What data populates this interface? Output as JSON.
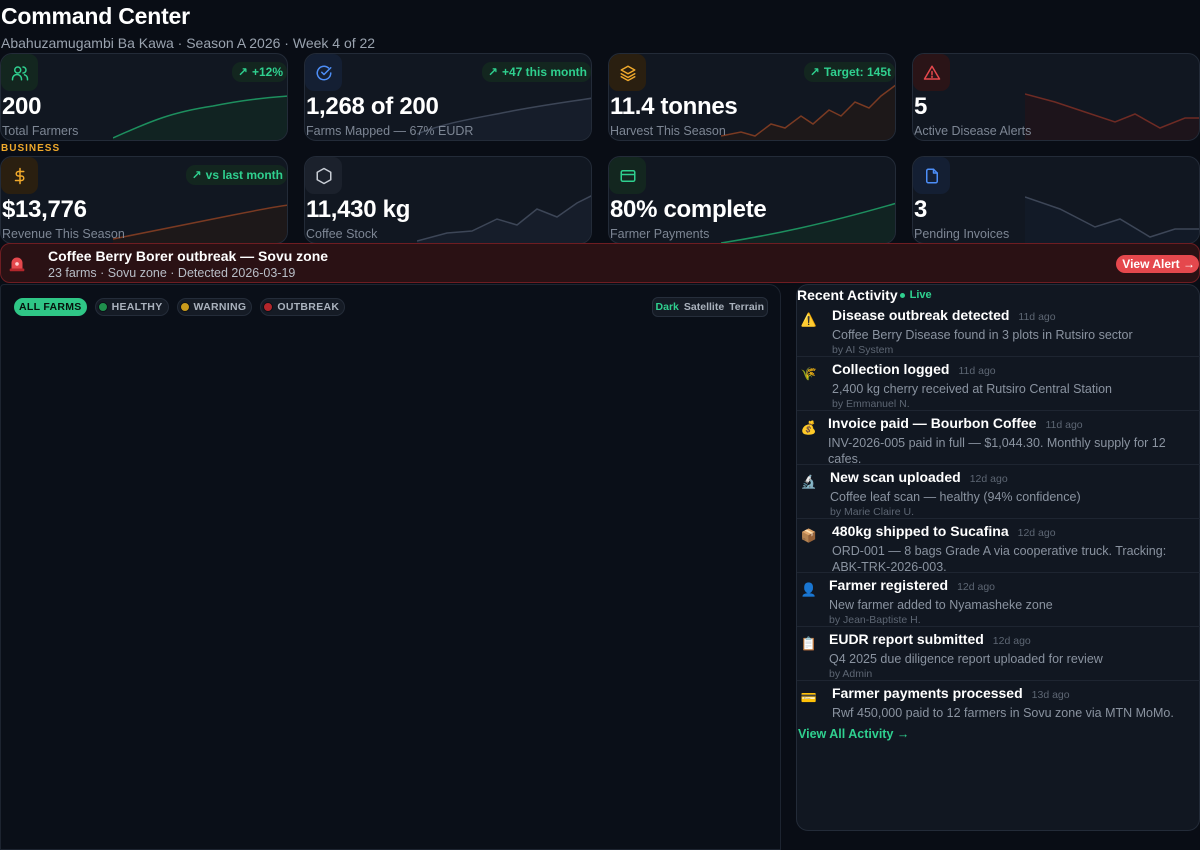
{
  "header": {
    "title": "Command Center",
    "subtitle": "Abahuzamugambi Ba Kawa · Season A 2026 · Week 4 of 22"
  },
  "colors": {
    "accent_green": "#2fd08f",
    "warning_orange": "#f0a92b",
    "danger_red": "#e5484d",
    "blue": "#4d8ef7",
    "background": "#090d15"
  },
  "stats": [
    {
      "icon": "users-icon",
      "value": "200",
      "label": "Total Farmers",
      "trend": "+12%",
      "icon_color": "#2fd08f"
    },
    {
      "icon": "check-circle-icon",
      "value": "1,268 of 200",
      "label": "Farms Mapped — 67% EUDR",
      "trend": "+47 this month",
      "icon_color": "#4d8ef7"
    },
    {
      "icon": "layers-icon",
      "value": "11.4 tonnes",
      "label": "Harvest This Season",
      "trend": "Target: 145t",
      "icon_color": "#f0a92b"
    },
    {
      "icon": "alert-triangle-icon",
      "value": "5",
      "label": "Active Disease Alerts",
      "trend": "",
      "icon_color": "#e5484d"
    }
  ],
  "business_label": "BUSINESS",
  "business": [
    {
      "icon": "dollar-icon",
      "value": "$13,776",
      "label": "Revenue This Season",
      "trend": "vs last month",
      "icon_color": "#f0a92b"
    },
    {
      "icon": "hexagon-icon",
      "value": "11,430 kg",
      "label": "Coffee Stock",
      "trend": "",
      "icon_color": "#c9ced6"
    },
    {
      "icon": "credit-card-icon",
      "value": "80% complete",
      "label": "Farmer Payments",
      "trend": "",
      "icon_color": "#2fd08f"
    },
    {
      "icon": "file-icon",
      "value": "3",
      "label": "Pending Invoices",
      "trend": "",
      "icon_color": "#4d8ef7"
    }
  ],
  "alert": {
    "title": "Coffee Berry Borer outbreak — Sovu zone",
    "subtitle": "23 farms · Sovu zone · Detected 2026-03-19",
    "button": "View Alert →"
  },
  "map": {
    "filters": [
      {
        "label": "ALL FARMS",
        "active": true,
        "color": ""
      },
      {
        "label": "HEALTHY",
        "active": false,
        "color": "#1f8f4c"
      },
      {
        "label": "WARNING",
        "active": false,
        "color": "#c99a1b"
      },
      {
        "label": "OUTBREAK",
        "active": false,
        "color": "#b3262b"
      }
    ],
    "layers": [
      "Dark",
      "Satellite",
      "Terrain"
    ],
    "active_layer": "Dark"
  },
  "activity": {
    "title": "Recent Activity",
    "live_label": "Live",
    "items": [
      {
        "icon": "⚠️",
        "title": "Disease outbreak detected",
        "ago": "11d ago",
        "desc": "Coffee Berry Disease found in 3 plots in Rutsiro sector",
        "by": "by AI System"
      },
      {
        "icon": "🌾",
        "title": "Collection logged",
        "ago": "11d ago",
        "desc": "2,400 kg cherry received at Rutsiro Central Station",
        "by": "by Emmanuel N."
      },
      {
        "icon": "💰",
        "title": "Invoice paid — Bourbon Coffee",
        "ago": "11d ago",
        "desc": "INV-2026-005 paid in full — $1,044.30. Monthly supply for 12 cafes.",
        "by": ""
      },
      {
        "icon": "🔬",
        "title": "New scan uploaded",
        "ago": "12d ago",
        "desc": "Coffee leaf scan — healthy (94% confidence)",
        "by": "by Marie Claire U."
      },
      {
        "icon": "📦",
        "title": "480kg shipped to Sucafina",
        "ago": "12d ago",
        "desc": "ORD-001 — 8 bags Grade A via cooperative truck. Tracking: ABK-TRK-2026-003.",
        "by": ""
      },
      {
        "icon": "👤",
        "title": "Farmer registered",
        "ago": "12d ago",
        "desc": "New farmer added to Nyamasheke zone",
        "by": "by Jean-Baptiste H."
      },
      {
        "icon": "📋",
        "title": "EUDR report submitted",
        "ago": "12d ago",
        "desc": "Q4 2025 due diligence report uploaded for review",
        "by": "by Admin"
      },
      {
        "icon": "💳",
        "title": "Farmer payments processed",
        "ago": "13d ago",
        "desc": "Rwf 450,000 paid to 12 farmers in Sovu zone via MTN MoMo.",
        "by": ""
      }
    ],
    "view_all": "View All Activity →"
  }
}
